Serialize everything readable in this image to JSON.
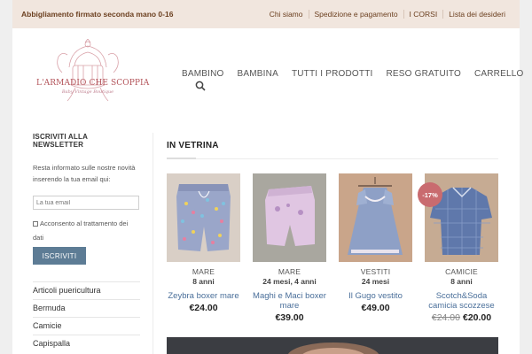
{
  "topbar": {
    "tagline": "Abbigliamento firmato seconda mano 0-16",
    "links": [
      "Chi siamo",
      "Spedizione e pagamento",
      "I CORSI",
      "Lista dei desideri"
    ]
  },
  "logo": {
    "title": "L'ARMADIO CHE SCOPPIA",
    "subtitle": "Baby Vintage Boutique"
  },
  "nav": {
    "items": [
      "BAMBINO",
      "BAMBINA",
      "TUTTI I PRODOTTI",
      "RESO GRATUITO",
      "CARRELLO"
    ]
  },
  "newsletter": {
    "title": "ISCRIVITI ALLA NEWSLETTER",
    "text": "Resta informato sulle nostre novità inserendo la tua email qui:",
    "email_placeholder": "La tua email",
    "consent": "Acconsento al trattamento dei dati",
    "button": "ISCRIVITI"
  },
  "categories": [
    "Articoli puericultura",
    "Bermuda",
    "Camicie",
    "Capispalla"
  ],
  "featured": {
    "title": "IN VETRINA",
    "products": [
      {
        "category": "MARE",
        "age": "8 anni",
        "name": "Zeybra boxer mare",
        "price": "€24.00",
        "old_price": "",
        "badge": ""
      },
      {
        "category": "MARE",
        "age": "24 mesi, 4 anni",
        "name": "Maghi e Maci boxer mare",
        "price": "€39.00",
        "old_price": "",
        "badge": ""
      },
      {
        "category": "VESTITI",
        "age": "24 mesi",
        "name": "Il Gugo vestito",
        "price": "€49.00",
        "old_price": "",
        "badge": ""
      },
      {
        "category": "CAMICIE",
        "age": "8 anni",
        "name": "Scotch&Soda camicia scozzese",
        "price": "€20.00",
        "old_price": "€24.00",
        "badge": "-17%"
      }
    ]
  },
  "colors": {
    "topbar_bg": "#f1e6de",
    "accent_link": "#4a6f9a",
    "button": "#5d7c95",
    "sale_badge": "#c96b6f"
  }
}
